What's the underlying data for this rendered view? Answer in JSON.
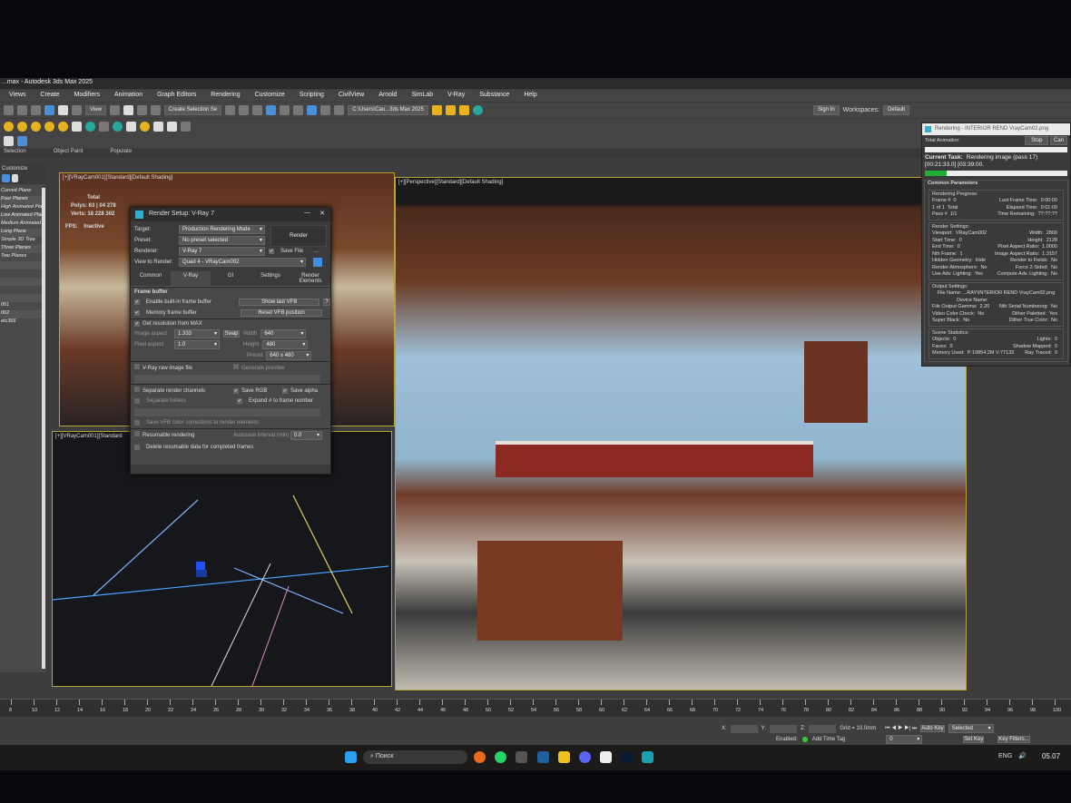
{
  "app": {
    "title": "...max - Autodesk 3ds Max 2025",
    "menu": [
      "Views",
      "Create",
      "Modifiers",
      "Animation",
      "Graph Editors",
      "Rendering",
      "Customize",
      "Scripting",
      "CivilView",
      "Arnold",
      "SimLab",
      "V-Ray",
      "Substance",
      "Help"
    ],
    "toolbar": {
      "view_dropdown": "View",
      "selection_set": "Create Selection Se",
      "project_path": "C:\\Users\\Cau...3ds Max 2025",
      "sign_in": "Sign In",
      "workspaces_label": "Workspaces:",
      "workspace": "Default"
    },
    "ribbon": [
      "Selection",
      "Object Paint",
      "Populate"
    ]
  },
  "left_panel": {
    "header": "Customize",
    "items": [
      "Curved Plane",
      "Four Planes",
      "High Animated Plane",
      "Low Animated Plane",
      "Medium Animated Plane",
      "Long Plane",
      "Simple 3D Tree",
      "Three Planes",
      "Two Planes",
      "",
      "",
      "",
      "",
      "",
      "001",
      "002",
      "etc366"
    ]
  },
  "viewports": {
    "top_left": {
      "label": "[+][VRayCam001][Standard][Default Shading]",
      "stats_total": "Total",
      "polys": "Polys: 63 | 04 278",
      "verts": "Verts: 18 228 302",
      "fps_label": "FPS:",
      "fps": "Inactive"
    },
    "bottom_left": {
      "label": "[+][VRayCam001][Standard"
    },
    "perspective": {
      "label": "[+][Perspective][Standard][Default Shading]"
    }
  },
  "render_setup": {
    "title": "Render Setup: V-Ray 7",
    "target_label": "Target:",
    "target": "Production Rendering Mode",
    "preset_label": "Preset:",
    "preset": "No preset selected",
    "renderer_label": "Renderer:",
    "renderer": "V-Ray 7",
    "save_file": "Save File",
    "more": "...",
    "view_label": "View to Render:",
    "view": "Quad 4 - VRayCam002",
    "render_button": "Render",
    "tabs": [
      "Common",
      "V-Ray",
      "GI",
      "Settings",
      "Render Elements"
    ],
    "frame_buffer": "Frame buffer",
    "enable_vfb": "Enable built-in frame buffer",
    "memory_fb": "Memory frame buffer",
    "show_last_vfb": "Show last VFB",
    "reset_vfb": "Reset VFB position",
    "help": "?",
    "get_res": "Get resolution from MAX",
    "swap": "Swap",
    "image_aspect_label": "Image aspect",
    "image_aspect": "1.333",
    "pixel_aspect_label": "Pixel aspect",
    "pixel_aspect": "1.0",
    "width_label": "Width",
    "width": "640",
    "height_label": "Height",
    "height": "480",
    "preset2_label": "Preset",
    "preset2": "640 x 480",
    "raw_file": "V-Ray raw image file",
    "gen_preview": "Generate preview",
    "sep_channels": "Separate render channels",
    "save_rgb": "Save RGB",
    "save_alpha": "Save alpha",
    "sep_folders": "Separate folders",
    "expand": "Expand # to frame number",
    "save_vfb_cc": "Save VFB color corrections to render elements",
    "resumable": "Resumable rendering",
    "autosave_label": "Autosave interval (min)",
    "autosave": "0.0",
    "delete_resumable": "Delete resumable data for completed frames"
  },
  "rendering_window": {
    "title": "Rendering - INTERIOR REND VrayCam02.png",
    "total_anim": "Total Animation:",
    "stop": "Stop",
    "cancel": "Can",
    "current_task_label": "Current Task:",
    "current_task": "Rendering image (pass 17) [00:21:33.0] [03:39:00.",
    "progress": 0.15,
    "common": "Common Parameters",
    "progress_hdr": "Rendering Progress:",
    "progress_rows": [
      [
        "Frame #",
        "0",
        "Last Frame Time:",
        "0:00:00"
      ],
      [
        "1 of 1",
        "Total",
        "Elapsed Time:",
        "0:01:09"
      ],
      [
        "Pass #",
        "1/1",
        "Time Remaining:",
        "??:??:??"
      ]
    ],
    "settings_hdr": "Render Settings:",
    "settings_rows": [
      [
        "Viewport:",
        "VRayCam002",
        "Width:",
        "2800"
      ],
      [
        "Start Time:",
        "0",
        "Height:",
        "2128"
      ],
      [
        "End Time:",
        "0",
        "Pixel Aspect Ratio:",
        "1.0000"
      ],
      [
        "Nth Frame:",
        "1",
        "Image Aspect Ratio:",
        "1.3157"
      ],
      [
        "Hidden Geometry:",
        "Hide",
        "Render to Fields:",
        "No"
      ],
      [
        "Render Atmosphere:",
        "No",
        "Force 2-Sided:",
        "No"
      ],
      [
        "Use Adv. Lighting:",
        "Yes",
        "Compute Adv. Lighting:",
        "No"
      ]
    ],
    "output_hdr": "Output Settings:",
    "file_name": "File Name: ...RAY\\INTERIOR REND VrayCam02.png",
    "device": "Device Name:",
    "output_rows": [
      [
        "File Output Gamma:",
        "2.20",
        "Nth Serial Numbering:",
        "No"
      ],
      [
        "Video Color Check:",
        "No",
        "Dither Paletted:",
        "Yes"
      ],
      [
        "Super Black:",
        "No",
        "Dither True Color:",
        "No"
      ]
    ],
    "scene_hdr": "Scene Statistics:",
    "scene_rows": [
      [
        "Objects:",
        "0",
        "Lights:",
        "0"
      ],
      [
        "Faces:",
        "0",
        "Shadow Mapped:",
        "0"
      ],
      [
        "Memory Used:",
        "P:19854.2M V:77133",
        "Ray Traced:",
        "0"
      ]
    ]
  },
  "timeline": {
    "ticks": [
      "8",
      "10",
      "12",
      "14",
      "16",
      "18",
      "20",
      "22",
      "24",
      "26",
      "28",
      "30",
      "32",
      "34",
      "36",
      "38",
      "40",
      "42",
      "44",
      "46",
      "48",
      "50",
      "52",
      "54",
      "56",
      "58",
      "60",
      "62",
      "64",
      "66",
      "68",
      "70",
      "72",
      "74",
      "76",
      "78",
      "80",
      "82",
      "84",
      "86",
      "88",
      "90",
      "92",
      "94",
      "96",
      "98",
      "100"
    ]
  },
  "status": {
    "x": "X:",
    "y": "Y:",
    "z": "Z:",
    "grid": "Grid = 10.0mm",
    "enabled": "Enabled:",
    "add_time_tag": "Add Time Tag",
    "frame": "0",
    "auto_key": "Auto Key",
    "set_key": "Set Key",
    "selected": "Selected",
    "key_filters": "Key Filters..."
  },
  "taskbar": {
    "search": "Поиск",
    "lang": "ENG",
    "clock": "05.07"
  },
  "colors": {
    "accent": "#4a8fd8",
    "viewport_border": "#b8a23a",
    "progress": "#1fae3a"
  }
}
